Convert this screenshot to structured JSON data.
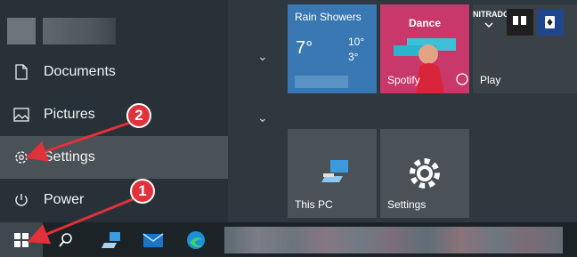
{
  "start_menu": {
    "items": [
      {
        "label": "Documents",
        "icon": "document-icon"
      },
      {
        "label": "Pictures",
        "icon": "pictures-icon"
      },
      {
        "label": "Settings",
        "icon": "gear-icon"
      },
      {
        "label": "Power",
        "icon": "power-icon"
      }
    ]
  },
  "tiles": {
    "weather": {
      "title": "Rain Showers",
      "temp": "7°",
      "high": "10°",
      "low": "3°"
    },
    "spotify": {
      "title": "Dance",
      "label": "Spotify"
    },
    "play": {
      "label": "Play",
      "nitrado": "NITRADO"
    },
    "this_pc": {
      "label": "This PC"
    },
    "settings": {
      "label": "Settings"
    }
  },
  "annotations": {
    "step1": "1",
    "step2": "2",
    "color": "#e1313a"
  },
  "colors": {
    "start_bg": "#2f383e",
    "taskbar": "#1c2327",
    "weather": "#3a78b3",
    "spotify": "#c9386b"
  }
}
